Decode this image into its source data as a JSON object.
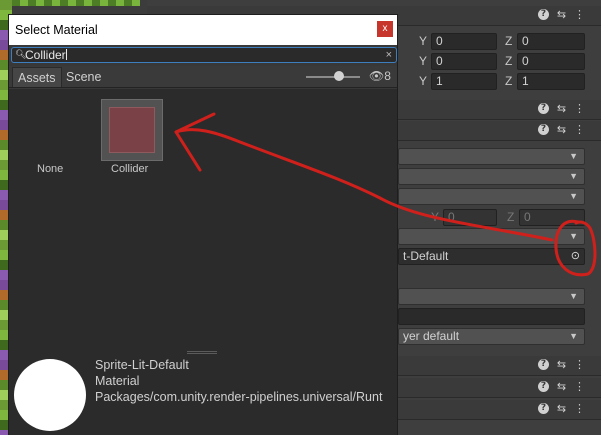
{
  "dialog": {
    "title": "Select Material",
    "close_glyph": "x",
    "search": {
      "value": "Collider",
      "clear_glyph": "×"
    },
    "tabs": [
      {
        "label": "Assets"
      },
      {
        "label": "Scene"
      }
    ],
    "hidden_count": "8",
    "items": [
      {
        "label": "None"
      },
      {
        "label": "Collider",
        "swatch_color": "#7a4146"
      }
    ],
    "preview": {
      "name": "Sprite-Lit-Default",
      "type": "Material",
      "path": "Packages/com.unity.render-pipelines.universal/Runt"
    }
  },
  "inspector": {
    "transform_fields": [
      {
        "y_label": "Y",
        "y_value": "0",
        "z_label": "Z",
        "z_value": "0"
      },
      {
        "y_label": "Y",
        "y_value": "0",
        "z_label": "Z",
        "z_value": "0"
      },
      {
        "y_label": "Y",
        "y_value": "1",
        "z_label": "Z",
        "z_value": "1"
      }
    ],
    "disabled_fields": {
      "y_label": "Y",
      "y_value": "0",
      "z_label": "Z",
      "z_value": "0"
    },
    "material_field_value": "t-Default",
    "sorting_layer_value": "yer default"
  },
  "colors": {
    "accent_focus": "#3d7ebf",
    "close_button": "#c7362d",
    "annotation_red": "#d0201c"
  }
}
